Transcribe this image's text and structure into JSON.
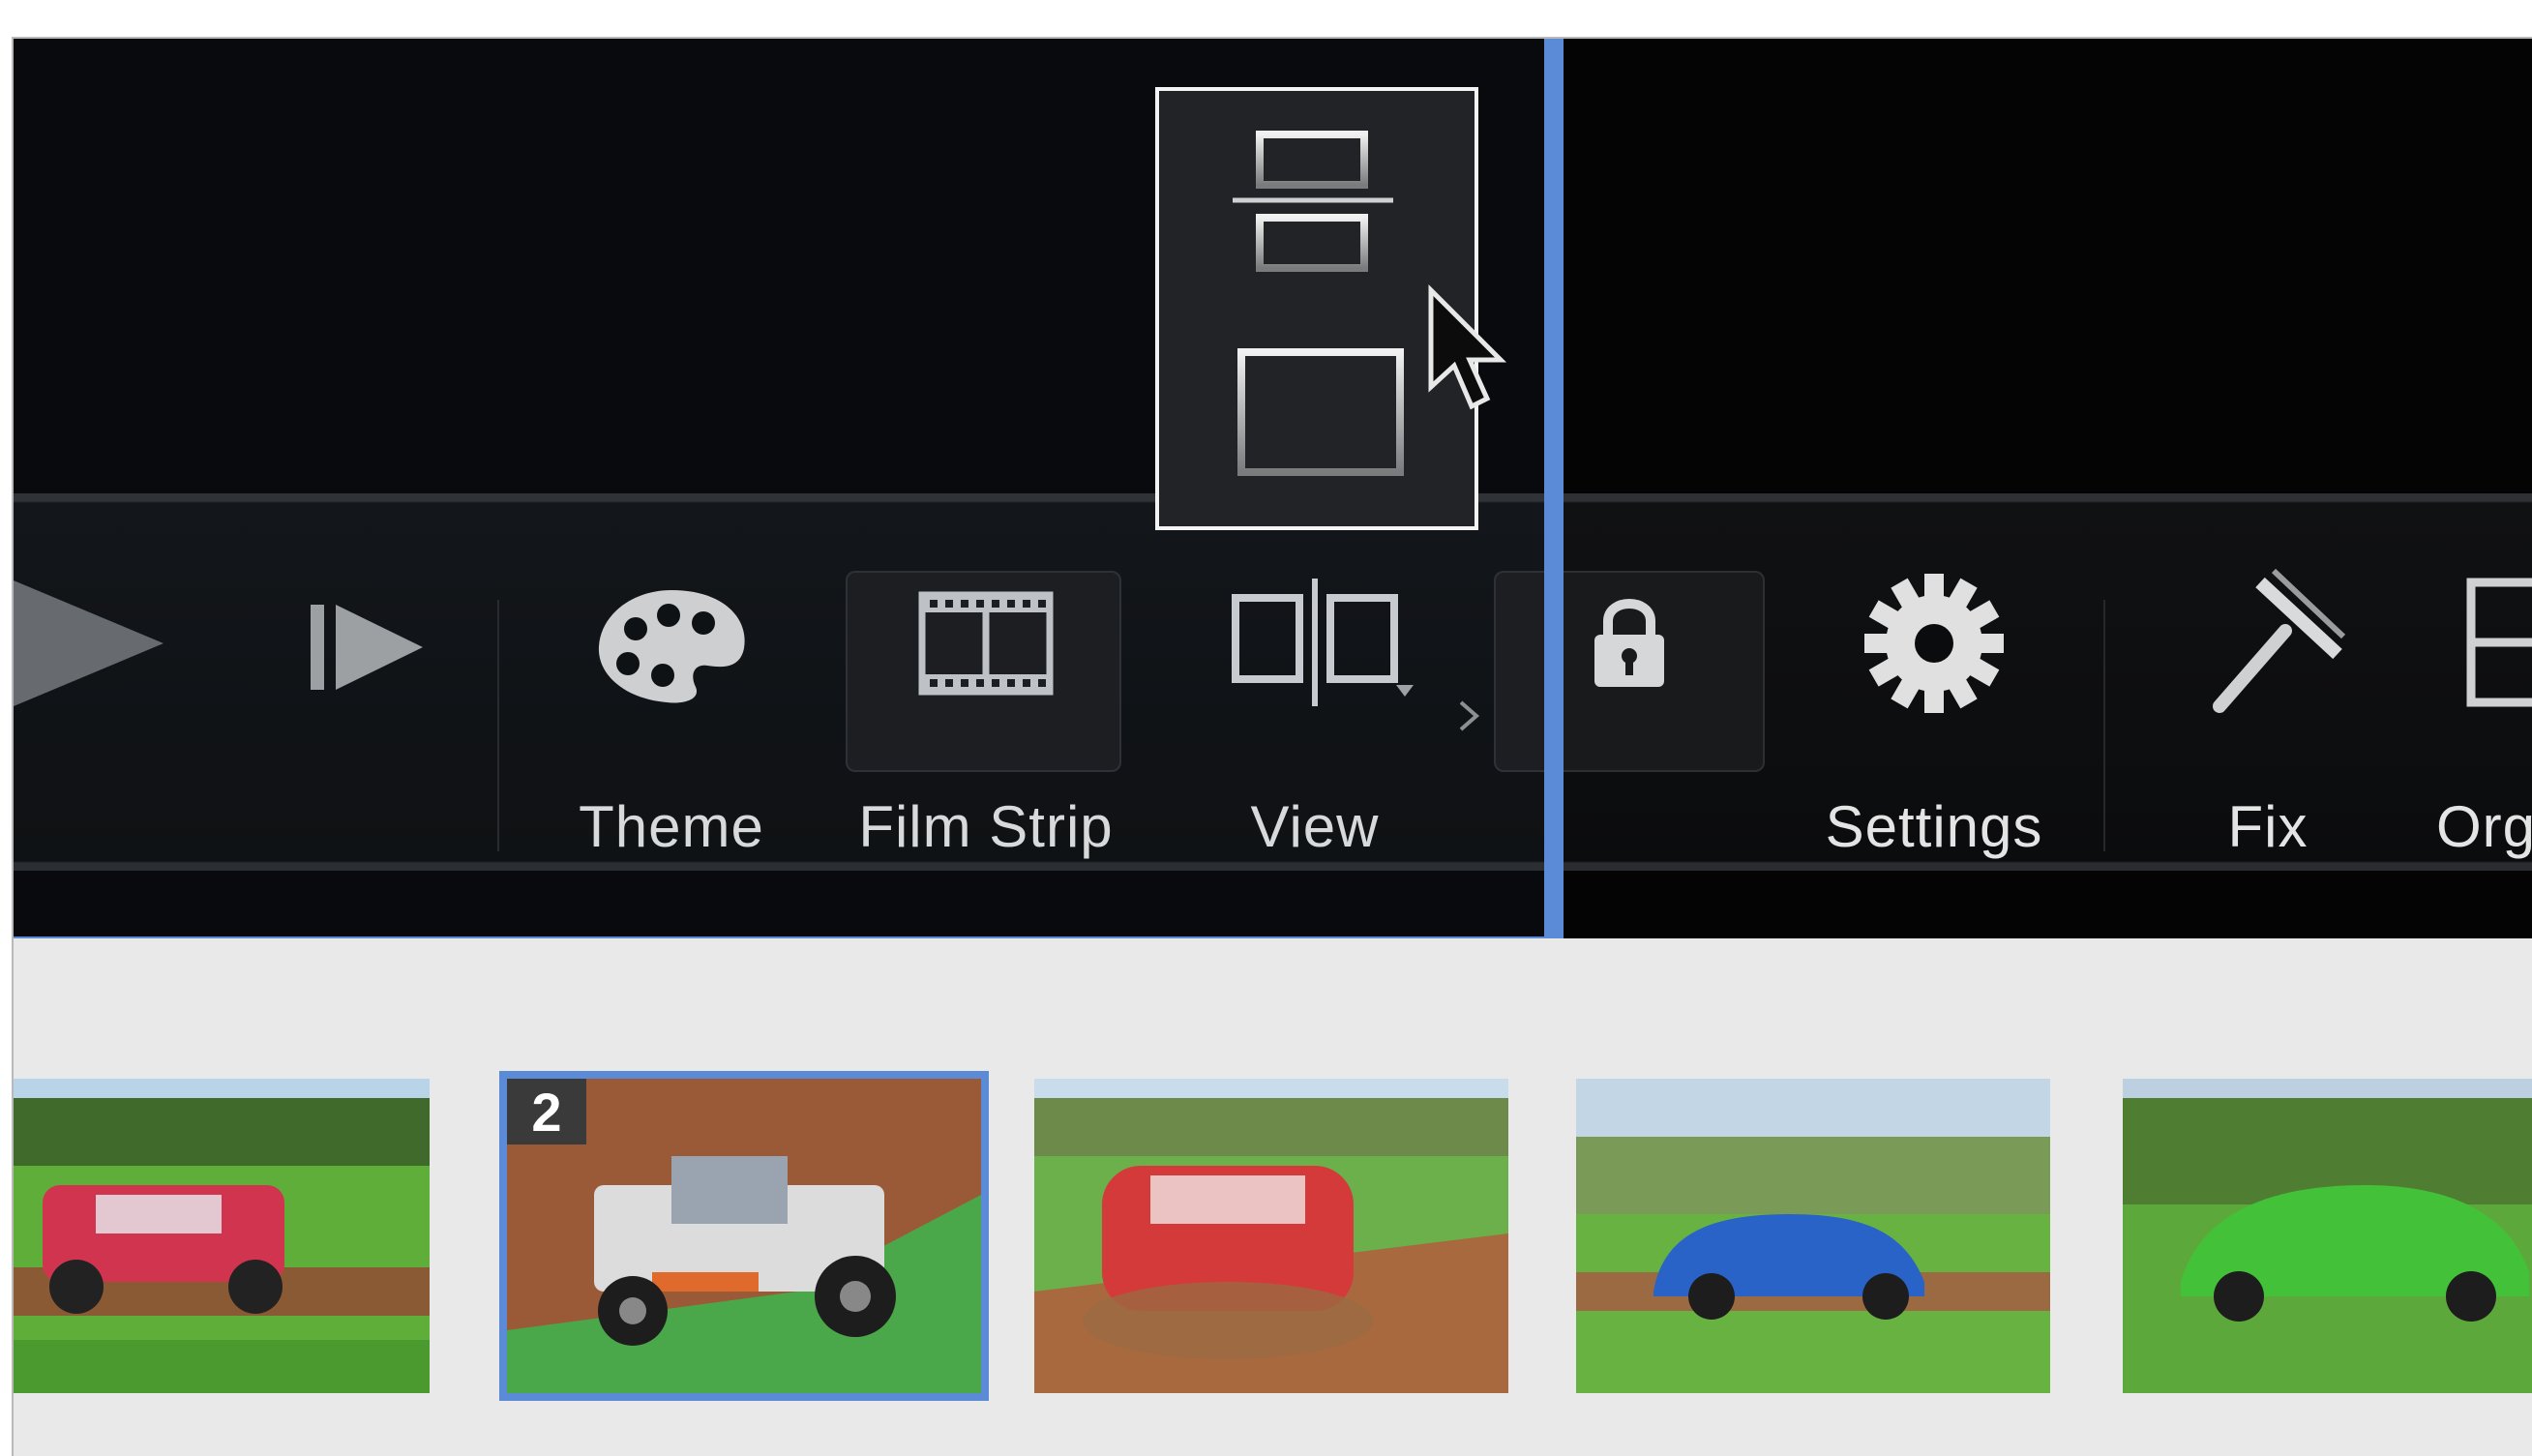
{
  "toolbar": {
    "items": [
      {
        "label": "",
        "icon": "play-icon"
      },
      {
        "label": "",
        "icon": "next-frame-icon"
      },
      {
        "label": "Theme",
        "icon": "palette-icon"
      },
      {
        "label": "Film Strip",
        "icon": "film-strip-icon"
      },
      {
        "label": "View",
        "icon": "split-view-icon"
      },
      {
        "label": "",
        "icon": "lock-icon"
      },
      {
        "label": "Settings",
        "icon": "gear-icon"
      },
      {
        "label": "Fix",
        "icon": "fix-icon"
      },
      {
        "label": "Org",
        "icon": "organize-icon"
      }
    ]
  },
  "layout_popup": {
    "options": [
      {
        "icon": "layout-stacked-icon"
      },
      {
        "icon": "layout-single-icon"
      }
    ]
  },
  "filmstrip": {
    "thumbnails": [
      {
        "badge": "",
        "selected": false,
        "subject": "red-hatchback-car"
      },
      {
        "badge": "2",
        "selected": true,
        "subject": "off-road-buggy"
      },
      {
        "badge": "",
        "selected": false,
        "subject": "red-mini-car"
      },
      {
        "badge": "",
        "selected": false,
        "subject": "blue-hatchback-car"
      },
      {
        "badge": "",
        "selected": false,
        "subject": "green-hatchback-car"
      }
    ]
  },
  "colors": {
    "accent": "#5b8ad6",
    "toolbar_bg": "#0b0c0d",
    "viewer_bg": "#040405",
    "filmstrip_bg": "#e9e9e9",
    "label_text": "#e4e4e4"
  }
}
